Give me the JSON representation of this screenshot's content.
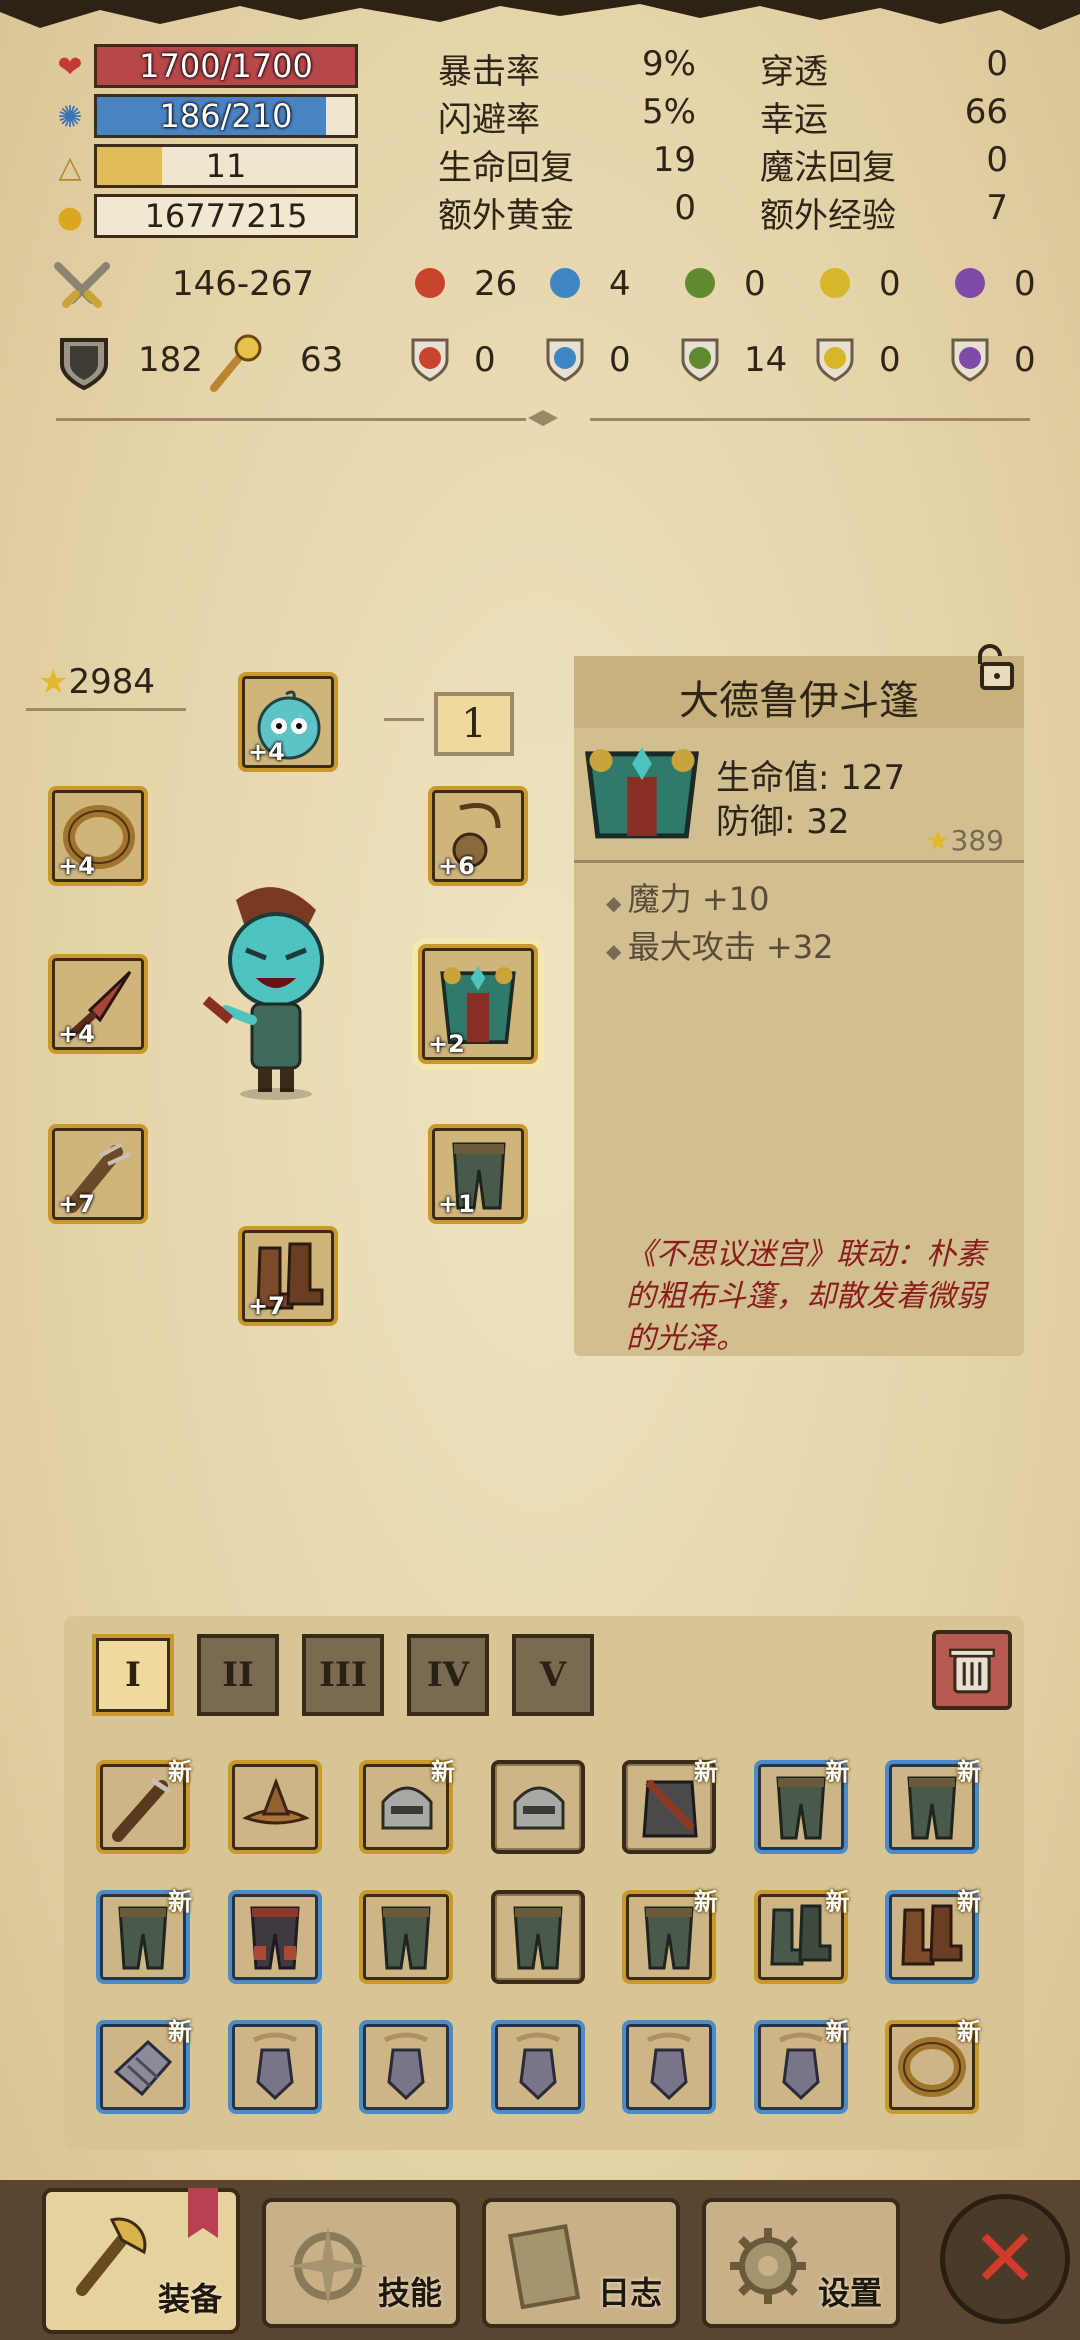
{
  "stats": {
    "hp": {
      "text": "1700/1700",
      "ratio": 1.0,
      "color": "#b8474a",
      "icon": "heart-icon"
    },
    "mp": {
      "text": "186/210",
      "ratio": 0.886,
      "color": "#4a83c1",
      "icon": "magic-icon"
    },
    "level": {
      "text": "11",
      "ratio": 0.25,
      "color": "#e0bd58",
      "icon": "level-icon"
    },
    "gold": {
      "text": "16777215",
      "ratio": 0,
      "color": "#e0bd58",
      "icon": "gold-icon"
    },
    "attrs": [
      {
        "label": "暴击率",
        "value": "9%"
      },
      {
        "label": "闪避率",
        "value": "5%"
      },
      {
        "label": "生命回复",
        "value": "19"
      },
      {
        "label": "额外黄金",
        "value": "0"
      },
      {
        "label": "穿透",
        "value": "0"
      },
      {
        "label": "幸运",
        "value": "66"
      },
      {
        "label": "魔法回复",
        "value": "0"
      },
      {
        "label": "额外经验",
        "value": "7"
      }
    ],
    "attack": "146-267",
    "defense": "182",
    "magic_power": "63",
    "elem_attack": [
      "26",
      "4",
      "0",
      "0",
      "0"
    ],
    "elem_resist": [
      "0",
      "0",
      "14",
      "0",
      "0"
    ],
    "elem_colors": [
      "#c8442c",
      "#3f86c4",
      "#5f8a2e",
      "#d8b62a",
      "#7f4aa8"
    ],
    "elem_icons": [
      "fire-icon",
      "water-icon",
      "leaf-icon",
      "lightning-icon",
      "arcane-icon"
    ]
  },
  "equipment": {
    "score": "2984",
    "slots": [
      {
        "name": "pet",
        "level": "+4"
      },
      {
        "name": "ring-left",
        "level": "+4"
      },
      {
        "name": "amulet",
        "level": "+6"
      },
      {
        "name": "weapon",
        "level": "+4"
      },
      {
        "name": "armor",
        "level": "+2"
      },
      {
        "name": "offhand",
        "level": "+7"
      },
      {
        "name": "pants",
        "level": "+1"
      },
      {
        "name": "boots",
        "level": "+7"
      }
    ],
    "armor_tier": "1"
  },
  "detail": {
    "title": "大德鲁伊斗篷",
    "stat1": "生命值: 127",
    "stat2": "防御: 32",
    "score": "389",
    "bonus1": "魔力 +10",
    "bonus2": "最大攻击 +32",
    "description": "《不思议迷宫》联动：朴素的粗布斗篷，却散发着微弱的光泽。"
  },
  "inventory": {
    "tabs": [
      "I",
      "II",
      "III",
      "IV",
      "V"
    ],
    "active_tab": 0,
    "new_label": "新",
    "items": [
      {
        "kind": "club",
        "border": "gold",
        "new": true
      },
      {
        "kind": "hat",
        "border": "gold",
        "new": false
      },
      {
        "kind": "helm",
        "border": "gold",
        "new": true
      },
      {
        "kind": "helm",
        "border": "plain",
        "new": false
      },
      {
        "kind": "chest",
        "border": "plain",
        "new": true
      },
      {
        "kind": "pants",
        "border": "blue",
        "new": true
      },
      {
        "kind": "pants",
        "border": "blue",
        "new": true
      },
      {
        "kind": "pants",
        "border": "blue",
        "new": true
      },
      {
        "kind": "pants-red",
        "border": "blue",
        "new": false
      },
      {
        "kind": "pants",
        "border": "gold",
        "new": false
      },
      {
        "kind": "pants",
        "border": "plain",
        "new": false
      },
      {
        "kind": "pants",
        "border": "gold",
        "new": true
      },
      {
        "kind": "boots",
        "border": "gold",
        "new": true
      },
      {
        "kind": "boots-red",
        "border": "blue",
        "new": true
      },
      {
        "kind": "gauntlet",
        "border": "blue",
        "new": true
      },
      {
        "kind": "amulet",
        "border": "blue",
        "new": false
      },
      {
        "kind": "amulet",
        "border": "blue",
        "new": false
      },
      {
        "kind": "amulet",
        "border": "blue",
        "new": false
      },
      {
        "kind": "amulet",
        "border": "blue",
        "new": false
      },
      {
        "kind": "amulet",
        "border": "blue",
        "new": true
      },
      {
        "kind": "ring",
        "border": "gold",
        "new": true
      }
    ]
  },
  "nav": {
    "equip": "装备",
    "skills": "技能",
    "log": "日志",
    "settings": "设置"
  }
}
